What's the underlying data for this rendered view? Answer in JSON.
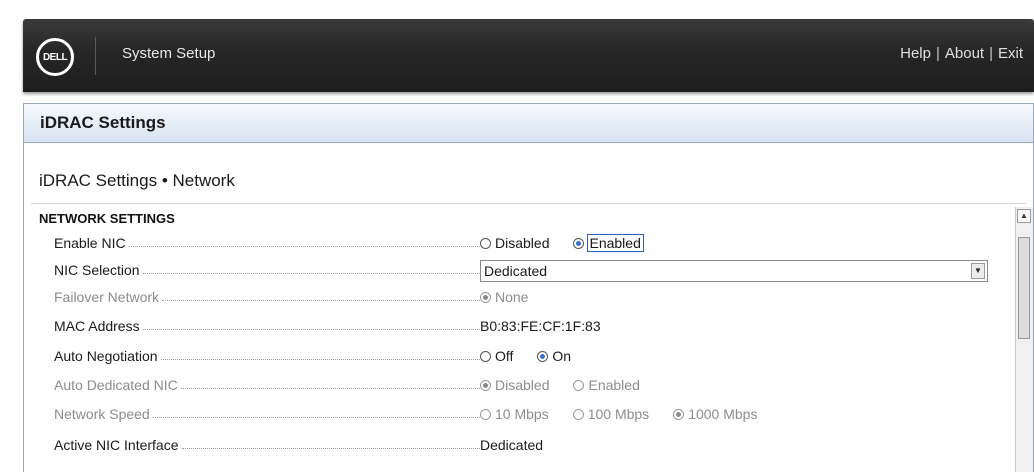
{
  "header": {
    "logo_text": "DELL",
    "app_title": "System Setup",
    "links": {
      "help": "Help",
      "about": "About",
      "exit": "Exit",
      "separator": "|"
    }
  },
  "section": {
    "title": "iDRAC Settings"
  },
  "page": {
    "subtitle": "iDRAC Settings • Network"
  },
  "group": {
    "heading": "NETWORK SETTINGS"
  },
  "fields": {
    "enable_nic": {
      "label": "Enable NIC",
      "options": [
        "Disabled",
        "Enabled"
      ],
      "selected": "Enabled"
    },
    "nic_selection": {
      "label": "NIC Selection",
      "value": "Dedicated"
    },
    "failover_network": {
      "label": "Failover Network",
      "options": [
        "None"
      ],
      "selected": "None"
    },
    "mac_address": {
      "label": "MAC Address",
      "value": "B0:83:FE:CF:1F:83"
    },
    "auto_negotiation": {
      "label": "Auto Negotiation",
      "options": [
        "Off",
        "On"
      ],
      "selected": "On"
    },
    "auto_dedicated_nic": {
      "label": "Auto Dedicated NIC",
      "options": [
        "Disabled",
        "Enabled"
      ],
      "selected": "Disabled"
    },
    "network_speed": {
      "label": "Network Speed",
      "options": [
        "10 Mbps",
        "100 Mbps",
        "1000 Mbps"
      ],
      "selected": "1000 Mbps"
    },
    "active_nic_interface": {
      "label": "Active NIC Interface",
      "value": "Dedicated"
    }
  },
  "icons": {
    "logo": "dell-logo",
    "scroll_up": "scroll-up-arrow-icon",
    "dropdown": "chevron-down-icon"
  },
  "colors": {
    "topbar": "#262626",
    "section_bg": "#d8e4f1",
    "radio_selected": "#3a72c8",
    "focus": "#2b5fb4"
  }
}
